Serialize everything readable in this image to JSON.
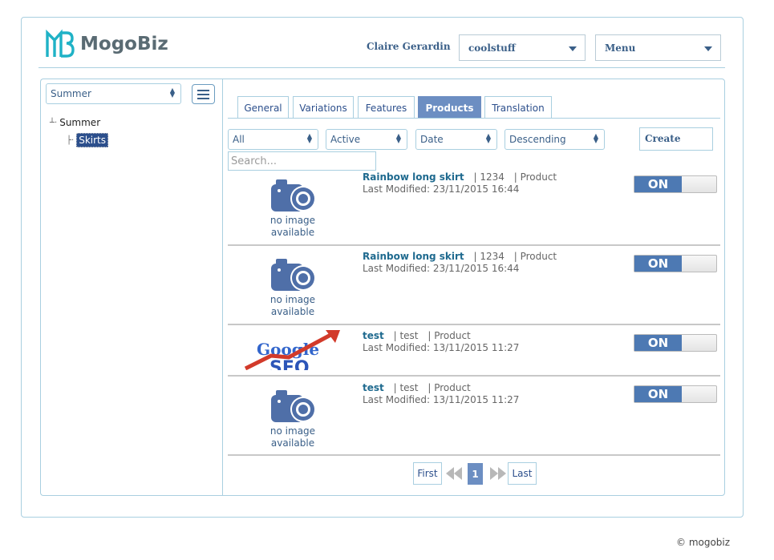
{
  "header": {
    "brand": "MogoBiz",
    "user_name": "Claire Gerardin",
    "store_select": "coolstuff",
    "menu_select": "Menu"
  },
  "sidebar": {
    "catalog_select": "Summer",
    "tree": {
      "root": "Summer",
      "child": "Skirts"
    }
  },
  "tabs": [
    {
      "label": "General",
      "active": false
    },
    {
      "label": "Variations",
      "active": false
    },
    {
      "label": "Features",
      "active": false
    },
    {
      "label": "Products",
      "active": true
    },
    {
      "label": "Translation",
      "active": false
    }
  ],
  "filters": {
    "status_all": "All",
    "active": "Active",
    "sort_by": "Date",
    "order": "Descending",
    "create_label": "Create",
    "search_placeholder": "Search..."
  },
  "products": [
    {
      "name": "Rainbow long skirt",
      "code": "1234",
      "type": "Product",
      "modified": "Last Modified: 23/11/2015 16:44",
      "image": "no-image",
      "toggle": "ON"
    },
    {
      "name": "Rainbow long skirt",
      "code": "1234",
      "type": "Product",
      "modified": "Last Modified: 23/11/2015 16:44",
      "image": "no-image",
      "toggle": "ON"
    },
    {
      "name": "test",
      "code": "test",
      "type": "Product",
      "modified": "Last Modified: 13/11/2015 11:27",
      "image": "google-seo",
      "toggle": "ON"
    },
    {
      "name": "test",
      "code": "test",
      "type": "Product",
      "modified": "Last Modified: 13/11/2015 11:27",
      "image": "no-image",
      "toggle": "ON"
    }
  ],
  "no_image_text": [
    "no image",
    "available"
  ],
  "seo_image_text": [
    "Google",
    "SEO"
  ],
  "pagination": {
    "first": "First",
    "current": "1",
    "last": "Last"
  },
  "footer": "© mogobiz",
  "colors": {
    "accent": "#6c8ec2",
    "toggle_on": "#4d79b3",
    "border": "#a9cfe0",
    "link": "#1f6a8f"
  }
}
